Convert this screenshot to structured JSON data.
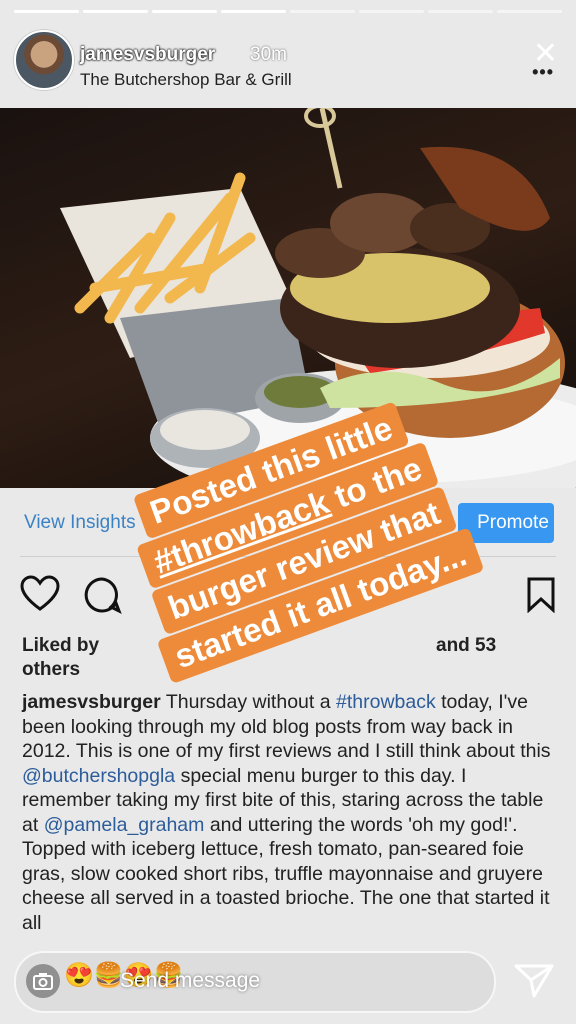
{
  "header": {
    "username": "jamesvsburger",
    "time": "30m",
    "location": "The Butchershop Bar & Grill",
    "close_icon": "✕",
    "more_icon": "•••"
  },
  "post": {
    "insights_label": "View Insights",
    "promote_label": "Promote",
    "likes_prefix": "Liked by",
    "likes_suffix": "and 53",
    "likes_others": "others",
    "caption_user": "jamesvsburger",
    "caption_text_1": " Thursday without a",
    "hashtag": "#throwback",
    "caption_text_2": " today, I've been looking through my old blog posts from way back in 2012. This is one of my first reviews and I still think about this",
    "mention_1": "@butchershopgla",
    "caption_text_3": " special menu burger to this day. I remember taking my first bite of this, staring across the table at",
    "mention_2": "@pamela_graham",
    "caption_text_4": " and uttering the words 'oh my god!'. Topped with iceberg lettuce, fresh tomato, pan-seared foie gras, slow cooked short ribs, truffle mayonnaise and gruyere cheese all served in a toasted brioche. The one that started it all"
  },
  "sticker": {
    "line1": "Posted this little",
    "line2_hashtag": "#throwback",
    "line2_rest": " to the",
    "line3": "burger review that",
    "line4": "started it all today..."
  },
  "reply": {
    "emojis": "😍🍔😍🍔",
    "placeholder": "Send message"
  },
  "colors": {
    "accent": "#3897f0",
    "sticker": "#ee8b3a",
    "link": "#2c5c99"
  }
}
